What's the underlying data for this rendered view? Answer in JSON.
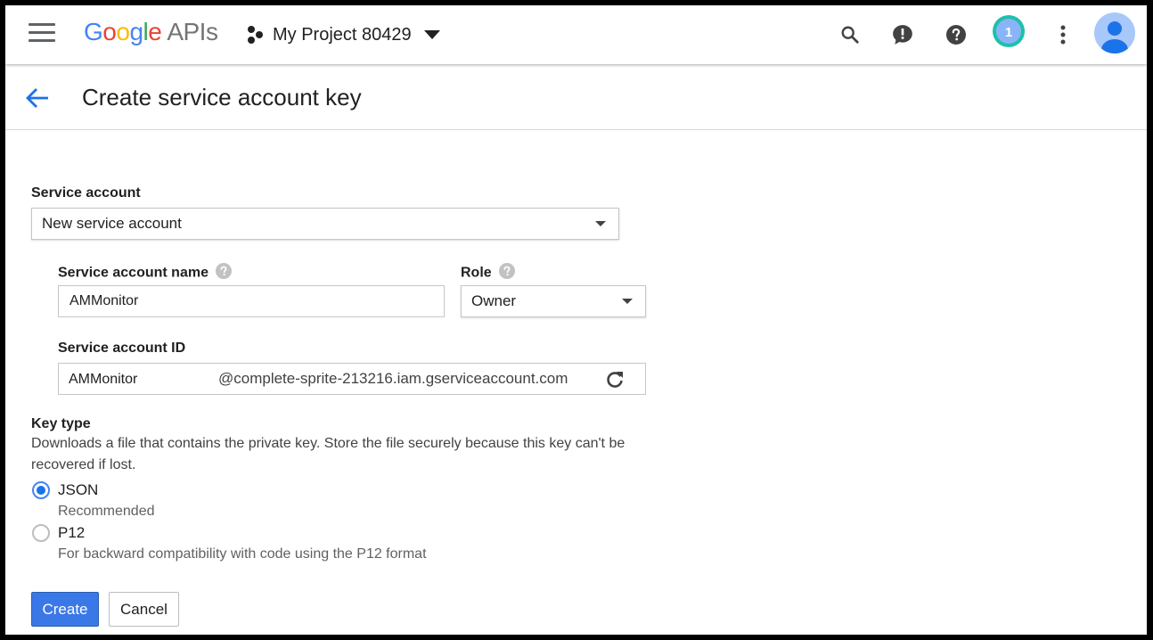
{
  "header": {
    "logo_google": [
      "G",
      "o",
      "o",
      "g",
      "l",
      "e"
    ],
    "logo_apis": "APIs",
    "project_name": "My Project 80429",
    "notification_count": "1",
    "icons": [
      "menu-icon",
      "search-icon",
      "feedback-icon",
      "help-icon",
      "more-vert-icon",
      "account-icon"
    ]
  },
  "page": {
    "title": "Create service account key"
  },
  "form": {
    "service_account_label": "Service account",
    "service_account_value": "New service account",
    "name_label": "Service account name",
    "name_value": "AMMonitor",
    "role_label": "Role",
    "role_value": "Owner",
    "id_label": "Service account ID",
    "id_value": "AMMonitor",
    "id_domain": "@complete-sprite-213216.iam.gserviceaccount.com",
    "key_type_label": "Key type",
    "key_type_desc": "Downloads a file that contains the private key. Store the file securely because this key can't be recovered if lost.",
    "options": [
      {
        "label": "JSON",
        "sub": "Recommended",
        "selected": true
      },
      {
        "label": "P12",
        "sub": "For backward compatibility with code using the P12 format",
        "selected": false
      }
    ]
  },
  "actions": {
    "create_label": "Create",
    "cancel_label": "Cancel"
  },
  "colors": {
    "primary": "#3b78e7",
    "badge": "#1ec0ab",
    "radio_selected": "#1a73e8"
  }
}
